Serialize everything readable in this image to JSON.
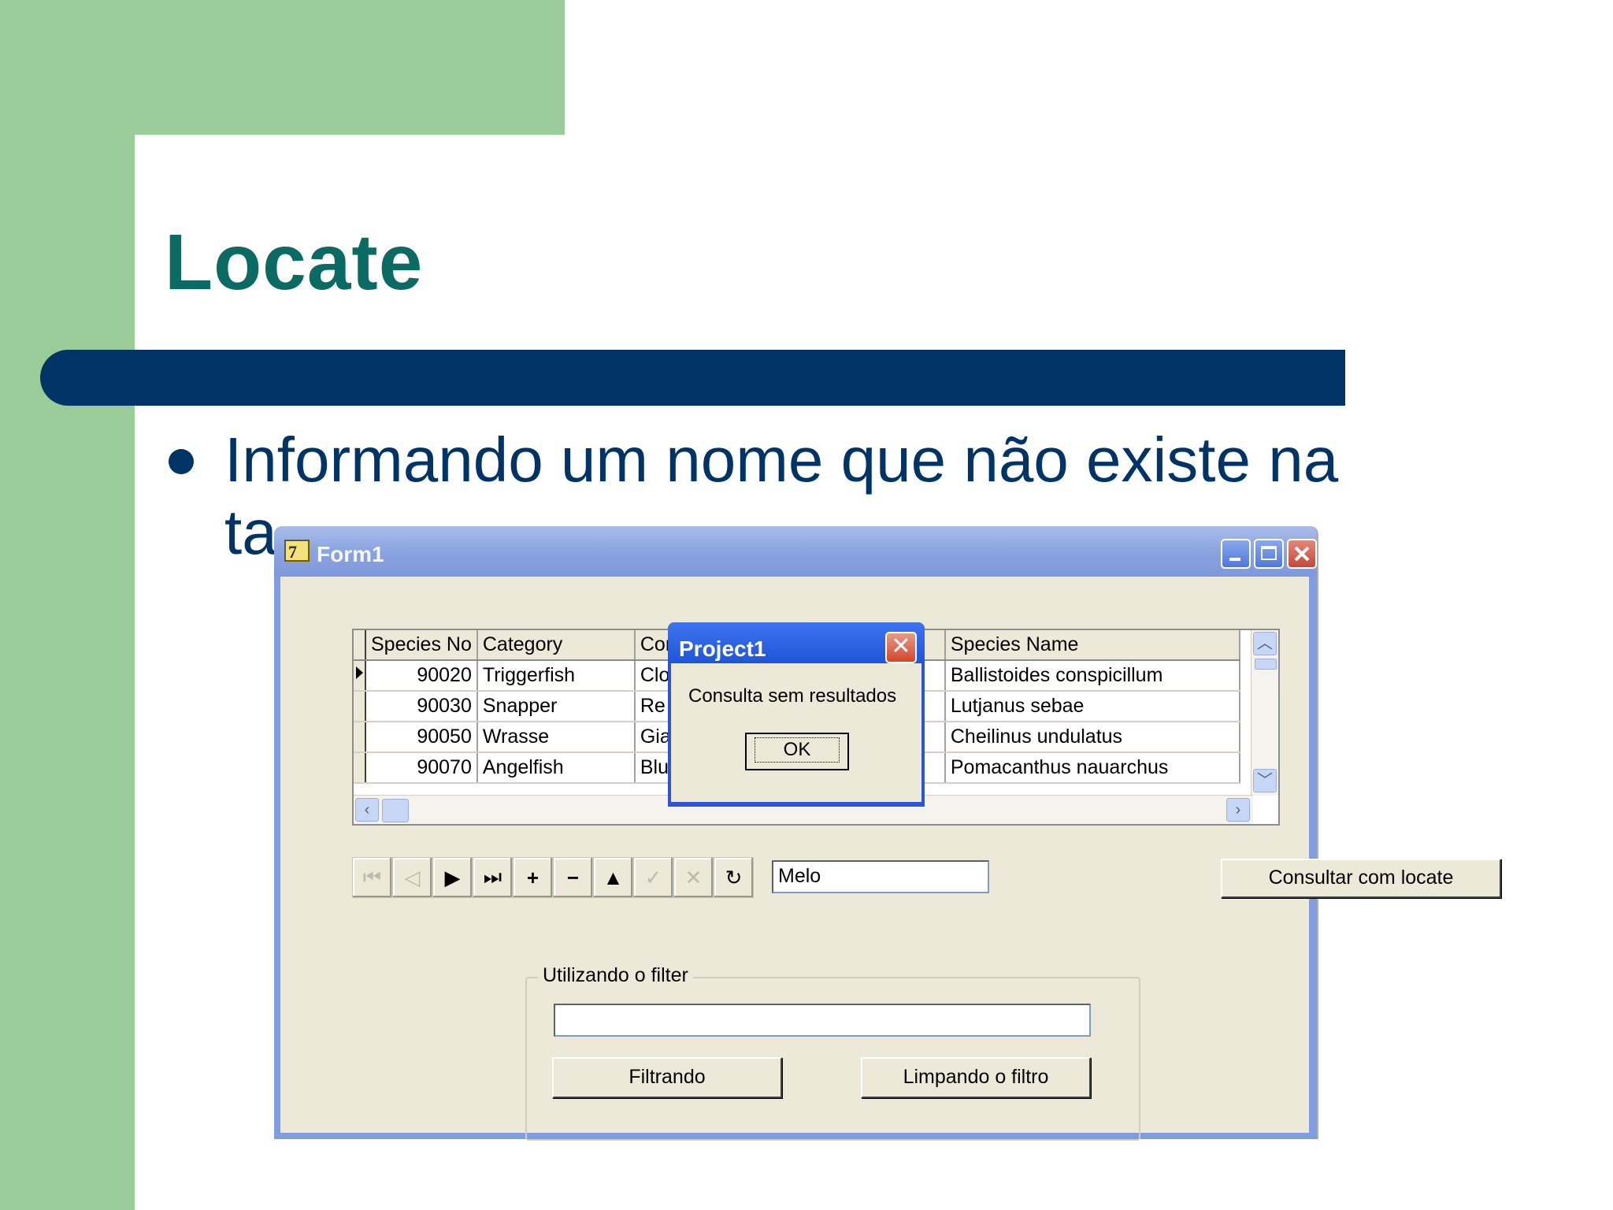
{
  "slide": {
    "title": "Locate",
    "bullet_line1": "Informando um nome que não existe na",
    "bullet_line2": "ta"
  },
  "window": {
    "title": "Form1"
  },
  "grid": {
    "columns": [
      "Species No",
      "Category",
      "Cor",
      "Species Name"
    ],
    "rows": [
      {
        "species_no": "90020",
        "category": "Triggerfish",
        "common": "Clo",
        "species_name": "Ballistoides conspicillum"
      },
      {
        "species_no": "90030",
        "category": "Snapper",
        "common": "Re",
        "species_name": "Lutjanus sebae"
      },
      {
        "species_no": "90050",
        "category": "Wrasse",
        "common": "Gia",
        "species_name": "Cheilinus undulatus"
      },
      {
        "species_no": "90070",
        "category": "Angelfish",
        "common": "Blu",
        "species_name": "Pomacanthus nauarchus"
      }
    ]
  },
  "search": {
    "value": "Melo",
    "button": "Consultar com locate"
  },
  "filter_group": {
    "label": "Utilizando o filter",
    "value": "",
    "apply_button": "Filtrando",
    "clear_button": "Limpando o filtro"
  },
  "dialog": {
    "title": "Project1",
    "message": "Consulta sem resultados",
    "ok": "OK"
  }
}
